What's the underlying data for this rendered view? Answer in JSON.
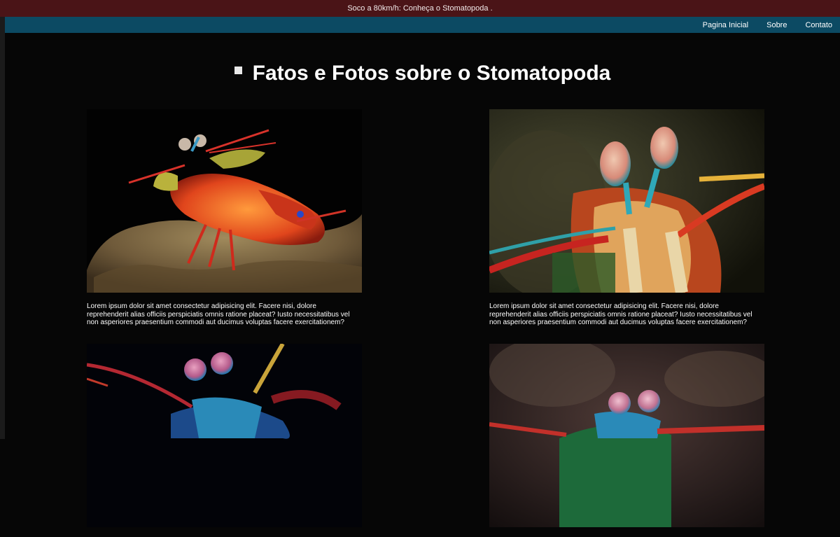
{
  "banner": {
    "text": "Soco a 80km/h: Conheça o Stomatopoda ."
  },
  "nav": {
    "items": [
      {
        "label": "Pagina Inicial"
      },
      {
        "label": "Sobre"
      },
      {
        "label": "Contato"
      }
    ]
  },
  "main": {
    "title": "Fatos e Fotos sobre o Stomatopoda",
    "cards": [
      {
        "caption": "Lorem ipsum dolor sit amet consectetur adipisicing elit. Facere nisi, dolore reprehenderit alias officiis perspiciatis omnis ratione placeat? Iusto necessitatibus vel non asperiores praesentium commodi aut ducimus voluptas facere exercitationem?"
      },
      {
        "caption": "Lorem ipsum dolor sit amet consectetur adipisicing elit. Facere nisi, dolore reprehenderit alias officiis perspiciatis omnis ratione placeat? Iusto necessitatibus vel non asperiores praesentium commodi aut ducimus voluptas facere exercitationem?"
      },
      {
        "caption": ""
      },
      {
        "caption": ""
      }
    ]
  },
  "colors": {
    "banner_bg": "#4a1417",
    "navbar_bg": "#0c4a63",
    "page_bg": "#060606"
  }
}
